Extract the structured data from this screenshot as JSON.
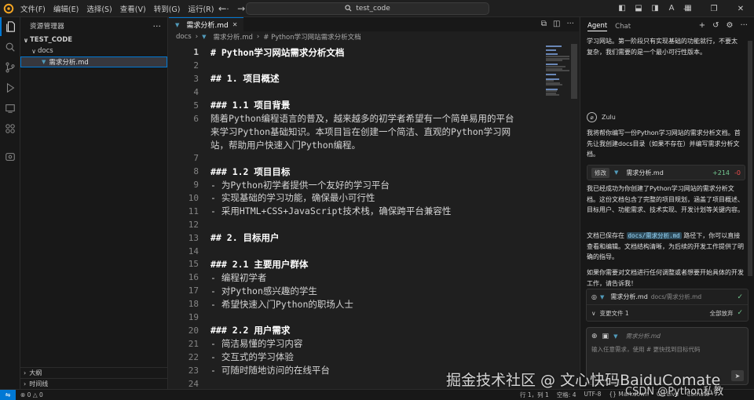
{
  "menubar": {
    "items": [
      "文件(F)",
      "编辑(E)",
      "选择(S)",
      "查看(V)",
      "转到(G)",
      "运行(R)",
      "..."
    ]
  },
  "command_center": {
    "text": "test_code"
  },
  "sidebar": {
    "title": "资源管理器",
    "root": "TEST_CODE",
    "folder": "docs",
    "file": "需求分析.md",
    "outline": "大纲",
    "timeline": "时间线"
  },
  "editor": {
    "tab_label": "需求分析.md",
    "breadcrumbs": [
      "docs",
      "需求分析.md",
      "# Python学习网站需求分析文档"
    ],
    "lines": [
      {
        "n": "1",
        "text": "# Python学习网站需求分析文档"
      },
      {
        "n": "2",
        "text": ""
      },
      {
        "n": "3",
        "text": "## 1. 项目概述"
      },
      {
        "n": "4",
        "text": ""
      },
      {
        "n": "5",
        "text": "### 1.1 项目背景"
      },
      {
        "n": "6",
        "text": "随着Python编程语言的普及，越来越多的初学者希望有一个简单易用的平台"
      },
      {
        "n": "",
        "text": "来学习Python基础知识。本项目旨在创建一个简洁、直观的Python学习网"
      },
      {
        "n": "",
        "text": "站，帮助用户快速入门Python编程。"
      },
      {
        "n": "7",
        "text": ""
      },
      {
        "n": "8",
        "text": "### 1.2 项目目标"
      },
      {
        "n": "9",
        "text": "- 为Python初学者提供一个友好的学习平台"
      },
      {
        "n": "10",
        "text": "- 实现基础的学习功能，确保最小可行性"
      },
      {
        "n": "11",
        "text": "- 采用HTML+CSS+JavaScript技术栈，确保跨平台兼容性"
      },
      {
        "n": "12",
        "text": ""
      },
      {
        "n": "13",
        "text": "## 2. 目标用户"
      },
      {
        "n": "14",
        "text": ""
      },
      {
        "n": "15",
        "text": "### 2.1 主要用户群体"
      },
      {
        "n": "16",
        "text": "- 编程初学者"
      },
      {
        "n": "17",
        "text": "- 对Python感兴趣的学生"
      },
      {
        "n": "18",
        "text": "- 希望快速入门Python的职场人士"
      },
      {
        "n": "19",
        "text": ""
      },
      {
        "n": "20",
        "text": "### 2.2 用户需求"
      },
      {
        "n": "21",
        "text": "- 简洁易懂的学习内容"
      },
      {
        "n": "22",
        "text": "- 交互式的学习体验"
      },
      {
        "n": "23",
        "text": "- 可随时随地访问的在线平台"
      },
      {
        "n": "24",
        "text": ""
      }
    ]
  },
  "agent": {
    "tab_agent": "Agent",
    "tab_chat": "Chat",
    "user_message": "学习网站。第一阶段只有实现基础的功能就行，不要太复杂，我们需要的是一个最小可行性版本。",
    "bot_name": "Zulu",
    "bot_msg1": "我将帮你编写一份Python学习网站的需求分析文档。首先让我创建docs目录（如果不存在）并编写需求分析文档。",
    "change_badge": "修改",
    "change_file": "需求分析.md",
    "change_add": "+214",
    "change_del": "-0",
    "bot_msg2": "我已经成功为你创建了Python学习网站的需求分析文档。这份文档包含了完整的项目规划，涵盖了项目概述、目标用户、功能需求、技术实现、开发计划等关键内容。",
    "bot_msg3_pre": "文档已保存在",
    "bot_msg3_path": "docs/需求分析.md",
    "bot_msg3_post": "路径下，你可以直接查看和编辑。文档结构清晰，为后续的开发工作提供了明确的指导。",
    "bot_msg4": "如果你需要对文档进行任何调整或者想要开始具体的开发工作，请告诉我！",
    "files_file": "需求分析.md",
    "files_path": "docs/需求分析.md",
    "files_changed": "变更文件 1",
    "files_accept_all": "全部放弃",
    "input_chip": "需求分析.md",
    "input_placeholder": "输入任意需求，使用 # 更快找到目标代码"
  },
  "statusbar": {
    "problems": "⊗ 0 △ 0",
    "position": "行 1，列 1",
    "spaces": "空格: 4",
    "encoding": "UTF-8",
    "eol": "{} Markdown",
    "live": "Go Live",
    "comate": "Comate"
  },
  "watermark": {
    "line1": "掘金技术社区 @ 文心快码BaiduComate",
    "line2": "CSDN @Python私教"
  }
}
